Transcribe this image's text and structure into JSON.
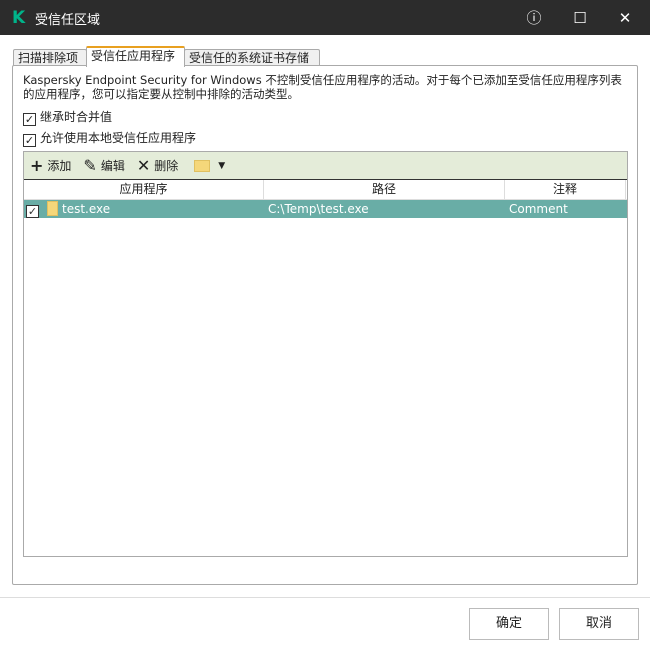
{
  "window": {
    "title": "受信任区域",
    "logo": "K"
  },
  "tabs": [
    "扫描排除项",
    "受信任应用程序",
    "受信任的系统证书存储"
  ],
  "description": "Kaspersky Endpoint Security for Windows 不控制受信任应用程序的活动。对于每个已添加至受信任应用程序列表的应用程序，您可以指定要从控制中排除的活动类型。",
  "checkboxes": [
    {
      "label": "继承时合并值",
      "checked": true
    },
    {
      "label": "允许使用本地受信任应用程序",
      "checked": true
    }
  ],
  "toolbar": {
    "add": "添加",
    "edit": "编辑",
    "delete": "删除"
  },
  "columns": [
    "应用程序",
    "路径",
    "注释"
  ],
  "rows": [
    {
      "checked": true,
      "app": "test.exe",
      "path": "C:\\Temp\\test.exe",
      "comment": "Comment"
    }
  ],
  "footer": {
    "ok": "确定",
    "cancel": "取消"
  }
}
